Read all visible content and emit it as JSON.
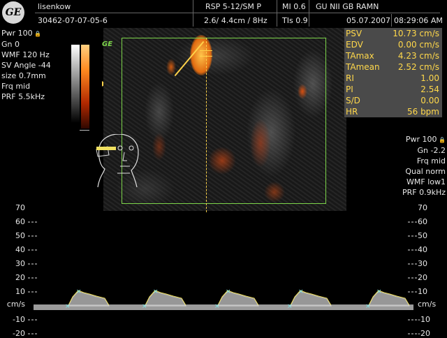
{
  "header": {
    "operator": "lisenkow",
    "patient_id": "30462-07-07-05-6",
    "probe": "RSP 5-12/SM P",
    "depth_freq": "2.6/ 4.4cm / 8Hz",
    "mi": "MI  0.6",
    "tis": "TIs  0.9",
    "institution": "GU NII GB RAMN",
    "date": "05.07.2007",
    "time": "08:29:06 AM"
  },
  "logo": {
    "text": "GE"
  },
  "left_params": [
    "Pwr 100",
    "Gn  0",
    "WMF 120 Hz",
    "SV Angle -44",
    "size  0.7mm",
    "Frq mid",
    "PRF  5.5kHz"
  ],
  "image": {
    "ge_tag": "GE"
  },
  "measurements": [
    {
      "label": "PSV",
      "value": "10.73 cm/s"
    },
    {
      "label": "EDV",
      "value": "0.00 cm/s"
    },
    {
      "label": "TAmax",
      "value": "4.23 cm/s"
    },
    {
      "label": "TAmean",
      "value": "2.52 cm/s"
    },
    {
      "label": "RI",
      "value": "1.00"
    },
    {
      "label": "PI",
      "value": "2.54"
    },
    {
      "label": "S/D",
      "value": "0.00"
    },
    {
      "label": "HR",
      "value": "56 bpm"
    }
  ],
  "right_params": [
    "Pwr 100",
    "Gn -2.2",
    "Frq mid",
    "Qual norm",
    "WMF low1",
    "PRF  0.9kHz"
  ],
  "spectrum": {
    "unit": "cm/s",
    "scale_labels": [
      "70",
      "60",
      "50",
      "40",
      "30",
      "20",
      "10",
      "-10",
      "-20"
    ]
  },
  "colors": {
    "measure_text": "#ffd84a",
    "color_box": "#7cd44a",
    "gate_line": "#ffd24a"
  }
}
